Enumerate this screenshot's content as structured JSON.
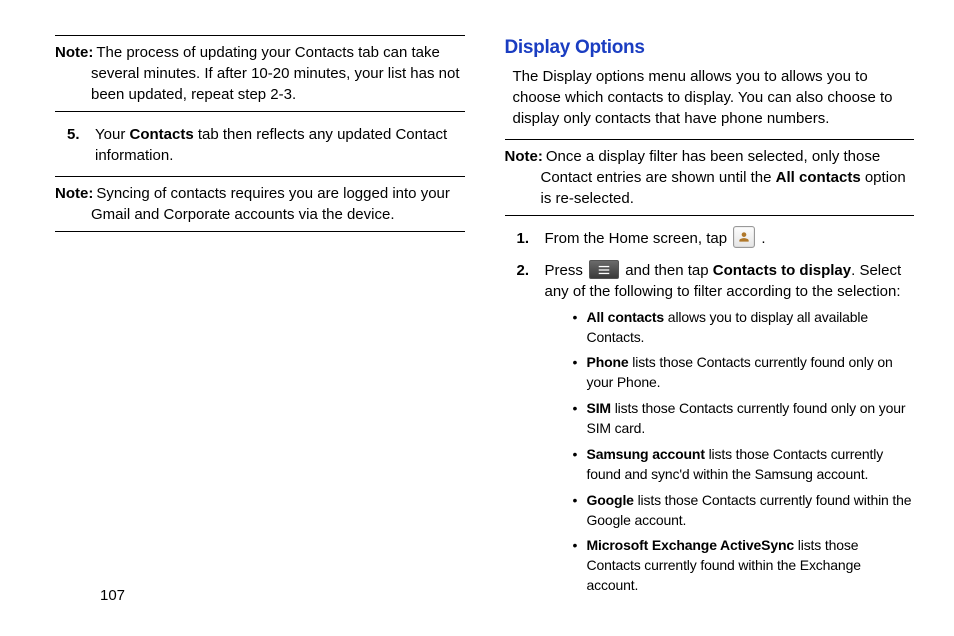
{
  "left": {
    "note1": {
      "label": "Note:",
      "line1": " The process of updating your Contacts tab can take",
      "line2": "several minutes. If after 10-20 minutes, your list has not been updated, repeat step 2-3."
    },
    "step5": {
      "num": "5.",
      "pre": "Your ",
      "bold": "Contacts",
      "post": " tab then reflects any updated Contact information."
    },
    "note2": {
      "label": "Note:",
      "line1": " Syncing of contacts requires you are logged into your",
      "line2": "Gmail and Corporate accounts via the device."
    }
  },
  "right": {
    "heading": "Display Options",
    "intro": "The Display options menu allows you to allows you to choose which contacts to display. You can also choose to display only contacts that have phone numbers.",
    "note": {
      "label": "Note:",
      "line1": " Once a display filter has been selected, only those",
      "line2a": "Contact entries are shown until the ",
      "line2b": "All contacts",
      "line2c": " option is re-selected."
    },
    "step1": {
      "num": "1.",
      "pre": "From the Home screen, tap ",
      "post": " ."
    },
    "step2": {
      "num": "2.",
      "pre": "Press ",
      "mid": " and then tap ",
      "bold": "Contacts to display",
      "post": ". Select any of the following to filter according to the selection:"
    },
    "bullets": [
      {
        "bold": "All contacts",
        "rest": " allows you to display all available Contacts."
      },
      {
        "bold": "Phone",
        "rest": " lists those Contacts currently found only on your Phone."
      },
      {
        "bold": "SIM",
        "rest": " lists those Contacts currently found only on your SIM card."
      },
      {
        "bold": "Samsung account",
        "rest": " lists those Contacts currently found and sync'd within the Samsung account."
      },
      {
        "bold": "Google",
        "rest": " lists those Contacts currently found within the Google account."
      },
      {
        "bold": "Microsoft Exchange ActiveSync",
        "rest": " lists those Contacts currently found within the Exchange account."
      }
    ]
  },
  "pageNumber": "107"
}
